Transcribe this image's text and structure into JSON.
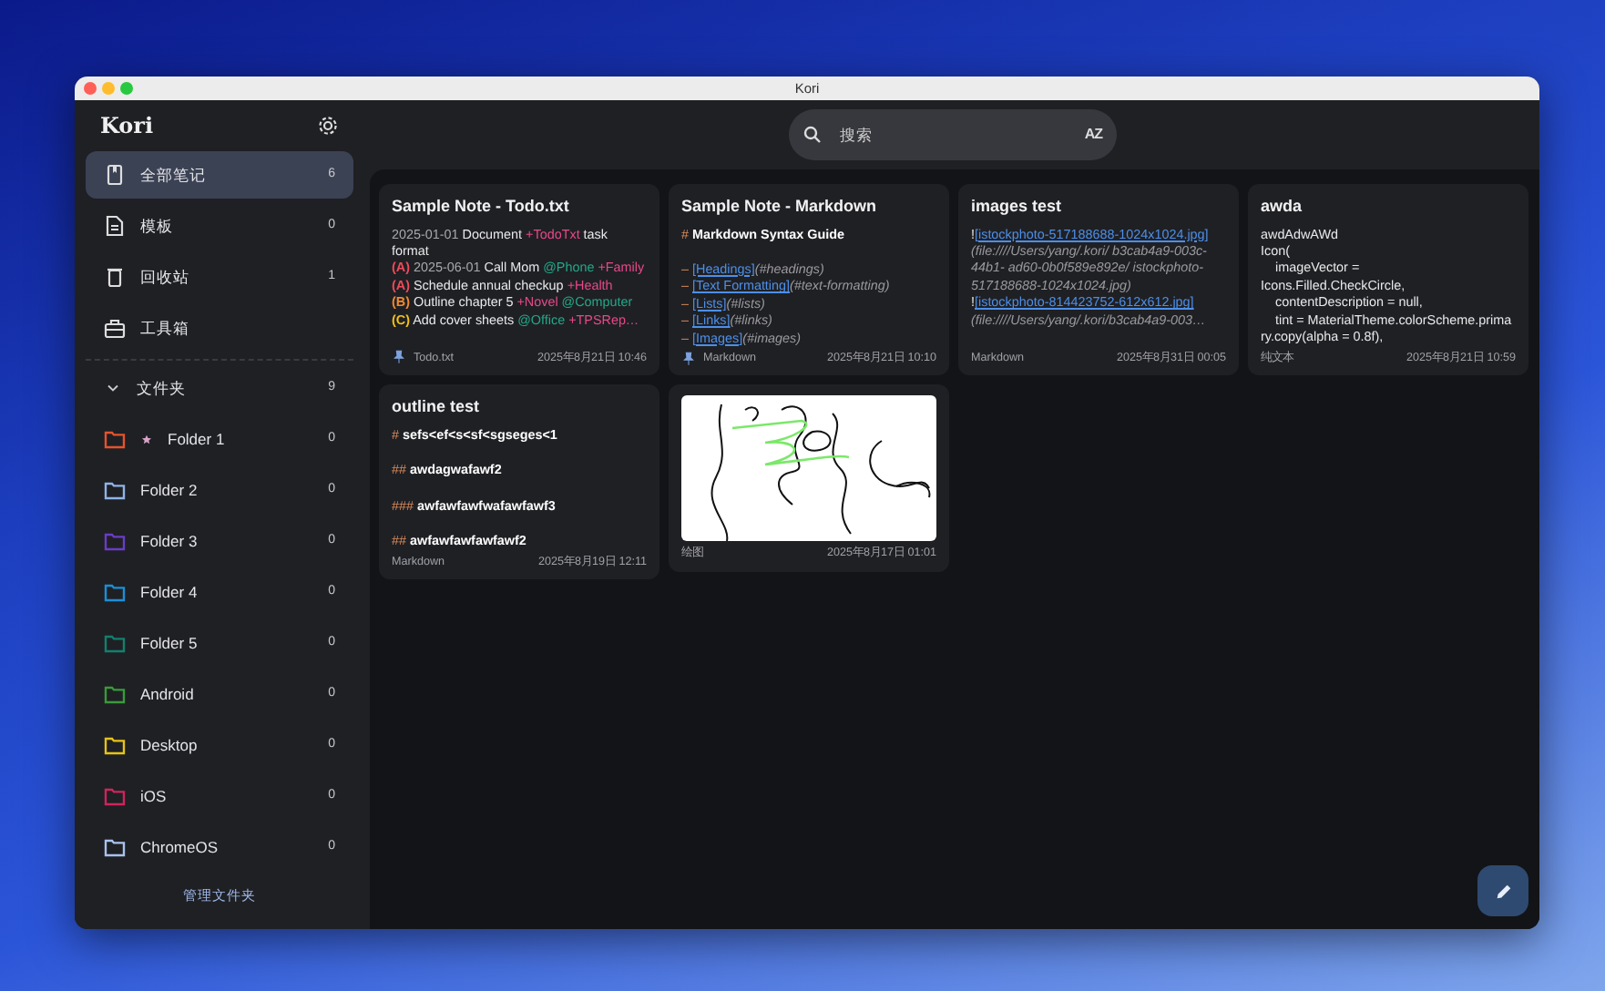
{
  "window": {
    "title": "Kori"
  },
  "sidebar": {
    "app_name": "Kori",
    "nav_items": [
      {
        "kind": "notebook",
        "label": "全部笔记",
        "count": "6",
        "selected": true
      },
      {
        "kind": "document",
        "label": "模板",
        "count": "0",
        "selected": false
      },
      {
        "kind": "trash",
        "label": "回收站",
        "count": "1",
        "selected": false
      },
      {
        "kind": "toolbox",
        "label": "工具箱",
        "selected": false
      }
    ],
    "folders_header": {
      "label": "文件夹",
      "count": "9",
      "expanded": true
    },
    "folders": [
      {
        "name": "Folder 1",
        "count": "0",
        "color": "#e5532d",
        "starred": true
      },
      {
        "name": "Folder 2",
        "count": "0",
        "color": "#8fb3e8",
        "starred": false
      },
      {
        "name": "Folder 3",
        "count": "0",
        "color": "#6a3cc8",
        "starred": false
      },
      {
        "name": "Folder 4",
        "count": "0",
        "color": "#1a8fd8",
        "starred": false
      },
      {
        "name": "Folder 5",
        "count": "0",
        "color": "#12806e",
        "starred": false
      },
      {
        "name": "Android",
        "count": "0",
        "color": "#3a9a3a",
        "starred": false
      },
      {
        "name": "Desktop",
        "count": "0",
        "color": "#e6c21a",
        "starred": false
      },
      {
        "name": "iOS",
        "count": "0",
        "color": "#d0245a",
        "starred": false
      },
      {
        "name": "ChromeOS",
        "count": "0",
        "color": "#a9c2ee",
        "starred": false
      }
    ],
    "manage_link": "管理文件夹"
  },
  "search": {
    "placeholder": "搜索",
    "sort_label": "AZ"
  },
  "notes": [
    {
      "kind": "text",
      "title": "Sample Note - Todo.txt",
      "lines": [
        [
          {
            "text": "2025-01-01",
            "kind": "date"
          },
          {
            "text": " Document ",
            "kind": "plain"
          },
          {
            "text": "+TodoTxt",
            "kind": "project"
          },
          {
            "text": " task format",
            "kind": "plain"
          }
        ],
        [
          {
            "text": "(A)",
            "kind": "pri_a"
          },
          {
            "text": " 2025-06-01",
            "kind": "date"
          },
          {
            "text": " Call Mom ",
            "kind": "plain"
          },
          {
            "text": "@Phone",
            "kind": "context"
          },
          {
            "text": " +Family",
            "kind": "project"
          }
        ],
        [
          {
            "text": "(A)",
            "kind": "pri_a"
          },
          {
            "text": " Schedule annual checkup ",
            "kind": "plain"
          },
          {
            "text": "+Health",
            "kind": "project"
          }
        ],
        [
          {
            "text": "(B)",
            "kind": "pri_b"
          },
          {
            "text": " Outline chapter 5 ",
            "kind": "plain"
          },
          {
            "text": "+Novel",
            "kind": "project"
          },
          {
            "text": " @Computer",
            "kind": "context"
          }
        ],
        [
          {
            "text": "(C)",
            "kind": "pri_c"
          },
          {
            "text": " Add cover sheets ",
            "kind": "plain"
          },
          {
            "text": "@Office",
            "kind": "context"
          },
          {
            "text": " +TPSRep…",
            "kind": "project"
          }
        ]
      ],
      "pinned": true,
      "type": "Todo.txt",
      "date": "2025年8月21日 10:46"
    },
    {
      "kind": "text",
      "title": "Sample Note - Markdown",
      "lines": [
        [
          {
            "text": "#",
            "kind": "mark"
          },
          {
            "text": " Markdown Syntax Guide",
            "kind": "heading"
          }
        ],
        [
          {
            "text": "– ",
            "kind": "mark"
          },
          {
            "text": "[Headings]",
            "kind": "link"
          },
          {
            "text": "(#headings)",
            "kind": "url"
          }
        ],
        [
          {
            "text": "– ",
            "kind": "mark"
          },
          {
            "text": "[Text Formatting]",
            "kind": "link"
          },
          {
            "text": "(#text-formatting)",
            "kind": "url"
          }
        ],
        [
          {
            "text": "– ",
            "kind": "mark"
          },
          {
            "text": "[Lists]",
            "kind": "link"
          },
          {
            "text": "(#lists)",
            "kind": "url"
          }
        ],
        [
          {
            "text": "– ",
            "kind": "mark"
          },
          {
            "text": "[Links]",
            "kind": "link"
          },
          {
            "text": "(#links)",
            "kind": "url"
          }
        ],
        [
          {
            "text": "– ",
            "kind": "mark"
          },
          {
            "text": "[Images]",
            "kind": "link"
          },
          {
            "text": "(#images)",
            "kind": "url"
          }
        ]
      ],
      "pinned": true,
      "type": "Markdown",
      "date": "2025年8月21日 10:10"
    },
    {
      "kind": "text",
      "title": "images test",
      "lines": [
        [
          {
            "text": "!",
            "kind": "plain"
          },
          {
            "text": "[istockphoto-517188688-1024x1024.jpg]",
            "kind": "link"
          },
          {
            "text": "(file:////Users/yang/.kori/ b3cab4a9-003c-44b1- ad60-0b0f589e892e/ istockphoto-517188688-1024x1024.jpg)",
            "kind": "url"
          }
        ],
        [
          {
            "text": "!",
            "kind": "plain"
          },
          {
            "text": "[istockphoto-814423752-612x612.jpg]",
            "kind": "link"
          }
        ],
        [
          {
            "text": "(file:////Users/yang/.kori/b3cab4a9-003…",
            "kind": "url"
          }
        ]
      ],
      "pinned": false,
      "type": "Markdown",
      "date": "2025年8月31日 00:05"
    },
    {
      "kind": "plain",
      "title": "awda",
      "lines": [
        [
          {
            "text": "awdAdwAWd",
            "kind": "plain"
          }
        ],
        [
          {
            "text": "Icon(",
            "kind": "plain"
          }
        ],
        [
          {
            "text": "    imageVector =",
            "kind": "plain"
          }
        ],
        [
          {
            "text": "Icons.Filled.CheckCircle,",
            "kind": "plain"
          }
        ],
        [
          {
            "text": "    contentDescription = null,",
            "kind": "plain"
          }
        ],
        [
          {
            "text": "    tint = MaterialTheme.colorScheme.primary.copy(alpha = 0.8f),",
            "kind": "plain"
          }
        ]
      ],
      "pinned": false,
      "type": "纯文本",
      "date": "2025年8月21日 10:59"
    },
    {
      "kind": "text",
      "title": "outline test",
      "lines": [
        [
          {
            "text": "#",
            "kind": "mark"
          },
          {
            "text": " sefs<ef<s<sf<sgseges<1",
            "kind": "heading"
          }
        ],
        [
          {
            "text": "##",
            "kind": "mark"
          },
          {
            "text": " awdagwafawf2",
            "kind": "heading"
          }
        ],
        [
          {
            "text": "###",
            "kind": "mark"
          },
          {
            "text": " awfawfawfwafawfawf3",
            "kind": "heading"
          }
        ],
        [
          {
            "text": "##",
            "kind": "mark"
          },
          {
            "text": " awfawfawfawfawf2",
            "kind": "heading"
          }
        ]
      ],
      "pinned": false,
      "type": "Markdown",
      "date": "2025年8月19日 12:11"
    },
    {
      "kind": "drawing",
      "pinned": false,
      "type": "绘图",
      "date": "2025年8月17日 01:01"
    }
  ]
}
